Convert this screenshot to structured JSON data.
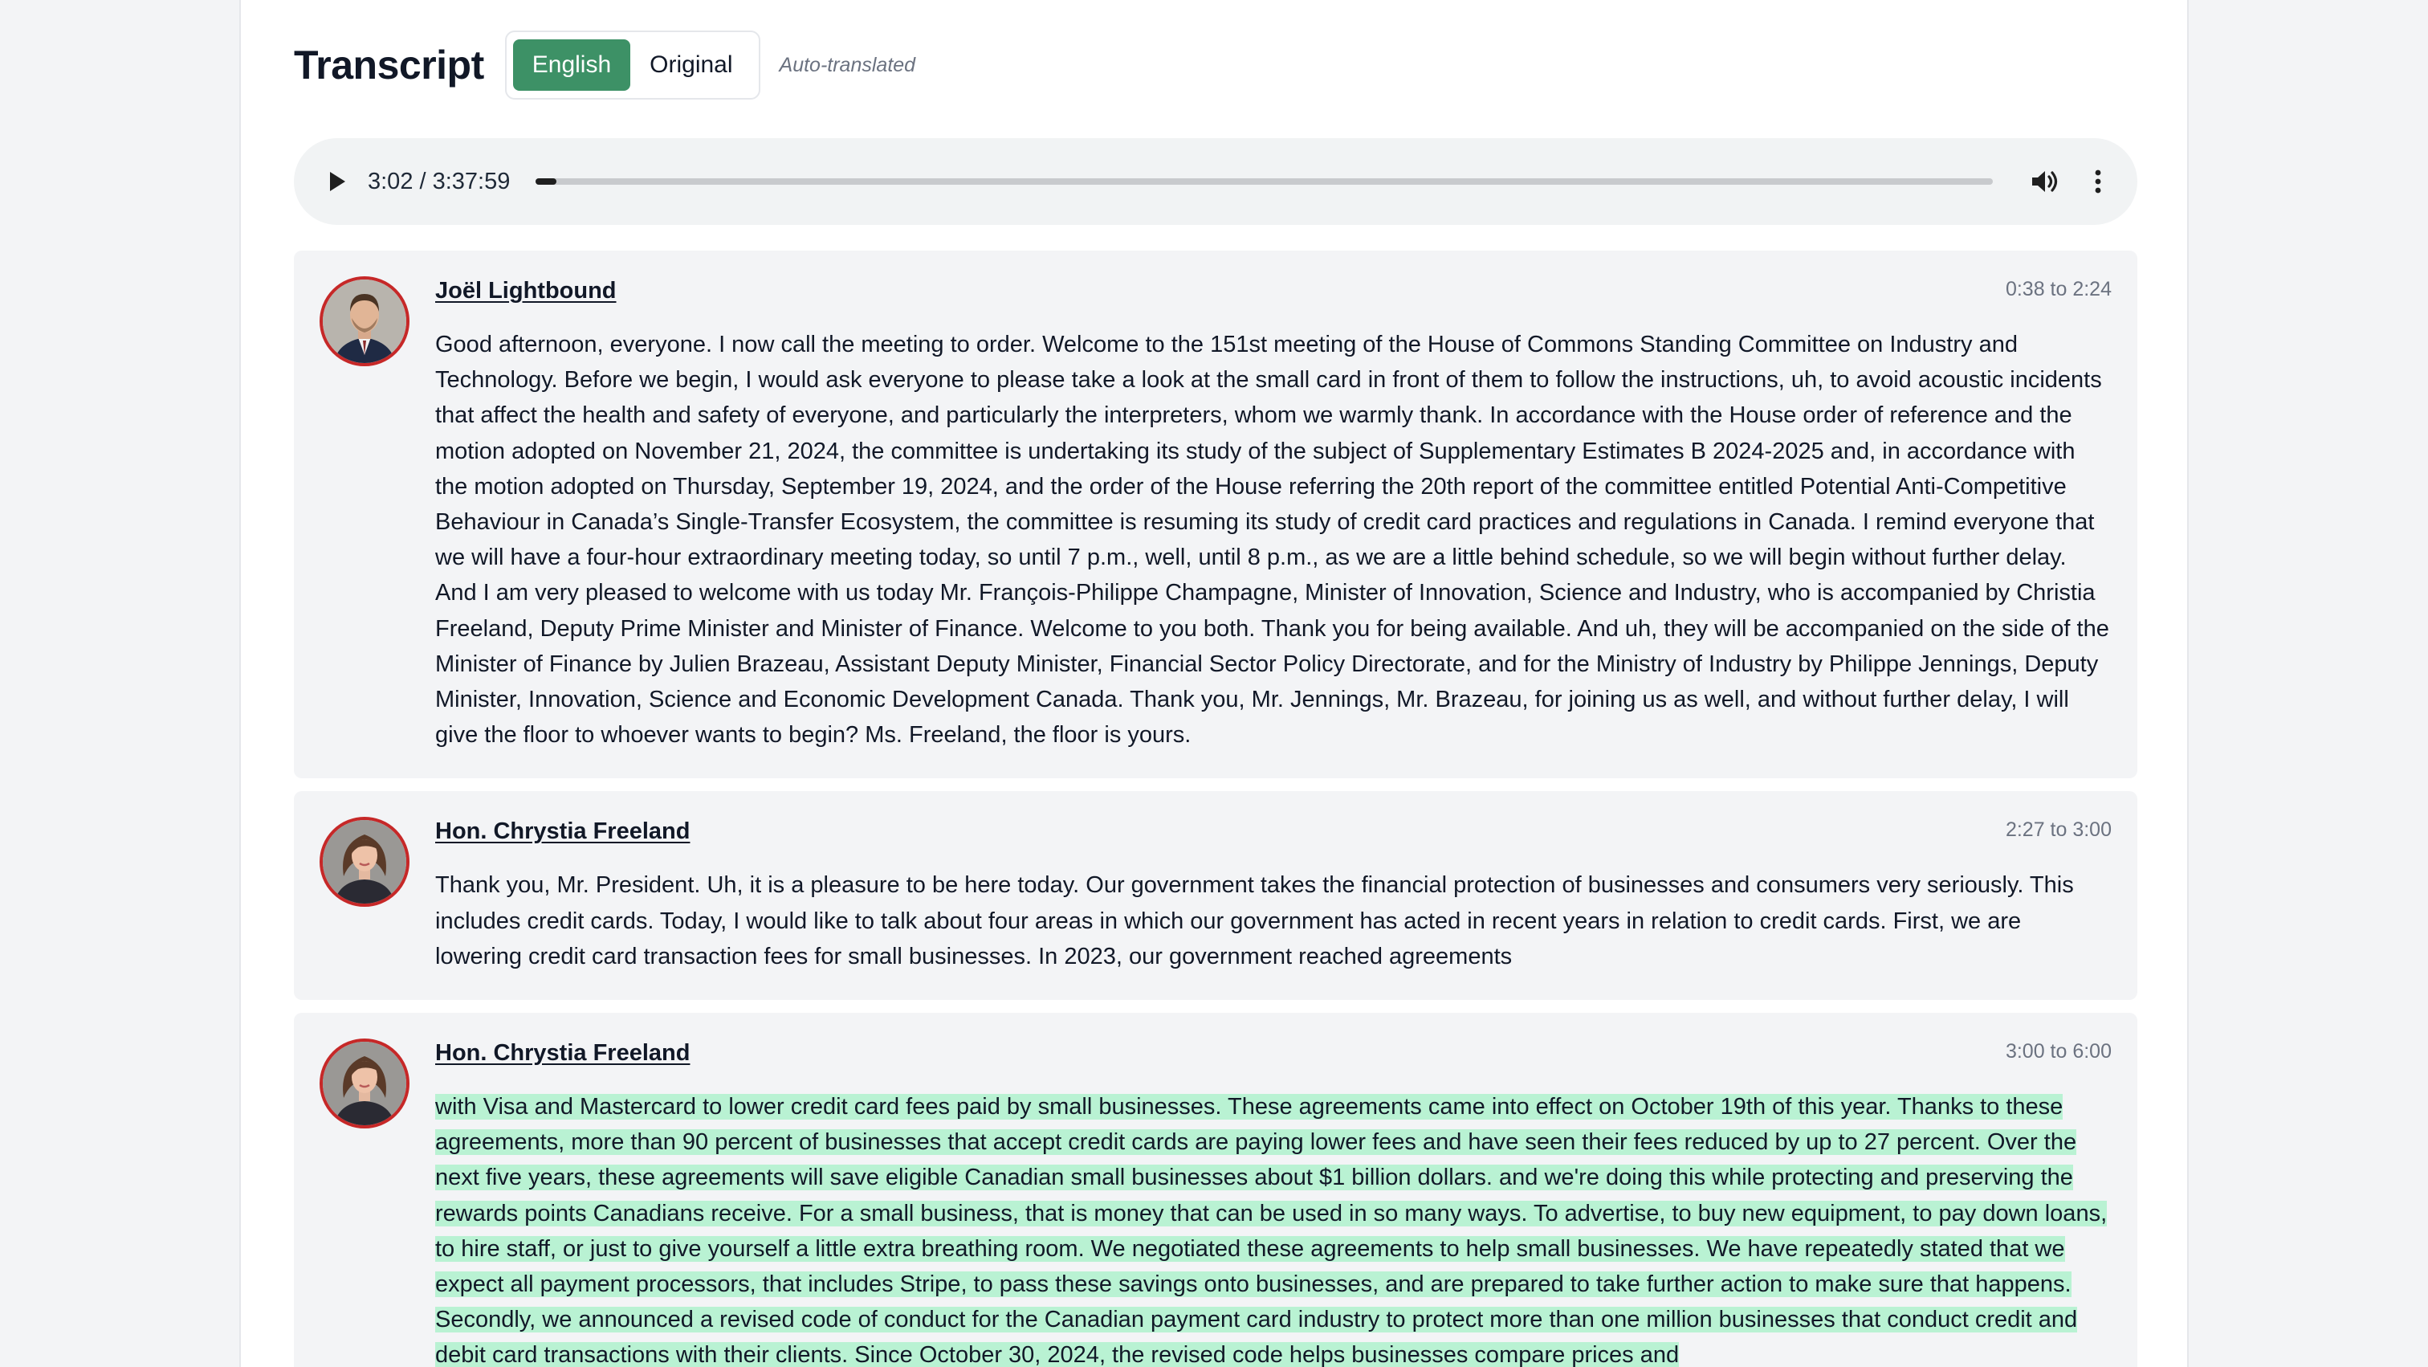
{
  "header": {
    "title": "Transcript",
    "lang_english": "English",
    "lang_original": "Original",
    "auto_note": "Auto-translated"
  },
  "player": {
    "time": "3:02 / 3:37:59",
    "progress_fraction": 0.0139
  },
  "segments": [
    {
      "speaker": "Joël Lightbound",
      "range": "0:38 to 2:24",
      "text": "Good afternoon, everyone. I now call the meeting to order. Welcome to the 151st meeting of the House of Commons Standing Committee on Industry and Technology. Before we begin, I would ask everyone to please take a look at the small card in front of them to follow the instructions, uh, to avoid acoustic incidents that affect the health and safety of everyone, and particularly the interpreters, whom we warmly thank. In accordance with the House order of reference and the motion adopted on November 21, 2024, the committee is undertaking its study of the subject of Supplementary Estimates B 2024-2025 and, in accordance with the motion adopted on Thursday, September 19, 2024, and the order of the House referring the 20th report of the committee entitled Potential Anti-Competitive Behaviour in Canada’s Single-Transfer Ecosystem, the committee is resuming its study of credit card practices and regulations in Canada. I remind everyone that we will have a four-hour extraordinary meeting today, so until 7 p.m., well, until 8 p.m., as we are a little behind schedule, so we will begin without further delay. And I am very pleased to welcome with us today Mr. François-Philippe Champagne, Minister of Innovation, Science and Industry, who is accompanied by Christia Freeland, Deputy Prime Minister and Minister of Finance. Welcome to you both. Thank you for being available. And uh, they will be accompanied on the side of the Minister of Finance by Julien Brazeau, Assistant Deputy Minister, Financial Sector Policy Directorate, and for the Ministry of Industry by Philippe Jennings, Deputy Minister, Innovation, Science and Economic Development Canada. Thank you, Mr. Jennings, Mr. Brazeau, for joining us as well, and without further delay, I will give the floor to whoever wants to begin? Ms. Freeland, the floor is yours."
    },
    {
      "speaker": "Hon. Chrystia Freeland",
      "range": "2:27 to 3:00",
      "text": "Thank you, Mr. President. Uh, it is a pleasure to be here today. Our government takes the financial protection of businesses and consumers very seriously. This includes credit cards. Today, I would like to talk about four areas in which our government has acted in recent years in relation to credit cards. First, we are lowering credit card transaction fees for small businesses. In 2023, our government reached agreements"
    },
    {
      "speaker": "Hon. Chrystia Freeland",
      "range": "3:00 to 6:00",
      "text": "with Visa and Mastercard to lower credit card fees paid by small businesses. These agreements came into effect on October 19th of this year. Thanks to these agreements, more than 90 percent of businesses that accept credit cards are paying lower fees and have seen their fees reduced by up to 27 percent. Over the next five years, these agreements will save eligible Canadian small businesses about $1 billion dollars. and we're doing this while protecting and preserving the rewards points Canadians receive. For a small business, that is money that can be used in so many ways. To advertise, to buy new equipment, to pay down loans, to hire staff, or just to give yourself a little extra breathing room. We negotiated these agreements to help small businesses. We have repeatedly stated that we expect all payment processors, that includes Stripe, to pass these savings onto businesses, and are prepared to take further action to make sure that happens. Secondly, we announced a revised code of conduct for the Canadian payment card industry to protect more than one million businesses that conduct credit and debit card transactions with their clients. Since October 30, 2024, the revised code helps businesses compare prices and"
    }
  ]
}
